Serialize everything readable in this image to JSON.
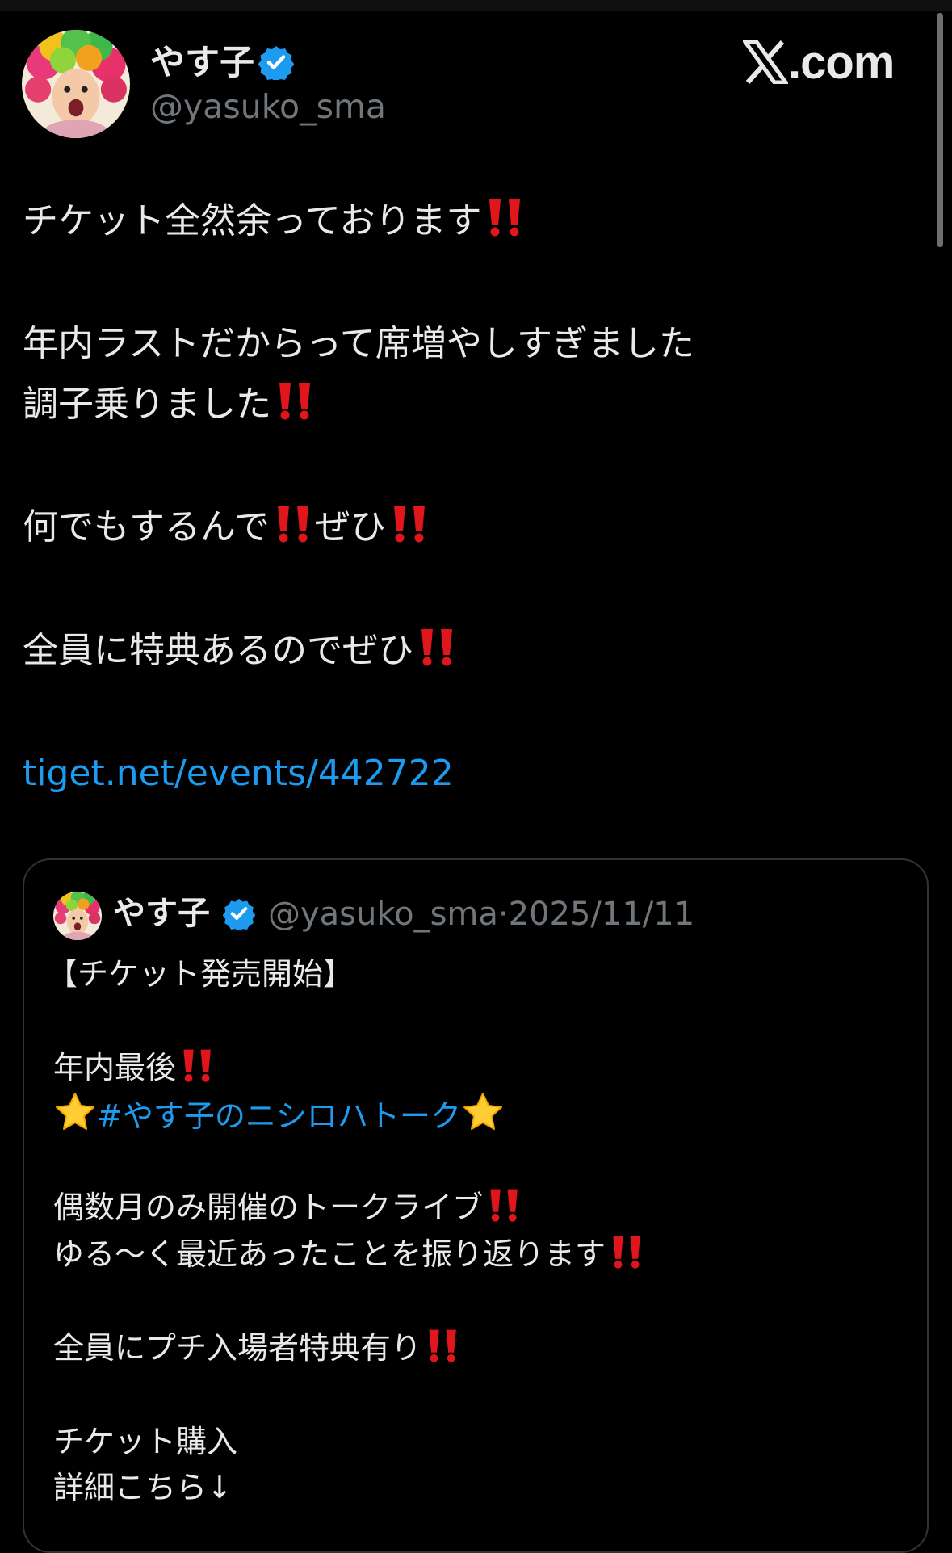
{
  "post": {
    "author": {
      "name": "やす子",
      "handle": "@yasuko_sma"
    },
    "brand": {
      "text": ".com"
    },
    "lines": {
      "l1": "チケット全然余っております",
      "l2": "年内ラストだからって席増やしすぎました",
      "l3": "調子乗りました",
      "l4a": "何でもするんで",
      "l4b": "ぜひ",
      "l5": "全員に特典あるのでぜひ",
      "link": "tiget.net/events/442722"
    }
  },
  "quote": {
    "author": {
      "name": "やす子",
      "handle": "@yasuko_sma",
      "separator": "·",
      "date": "2025/11/11"
    },
    "lines": {
      "q1": "【チケット発売開始】",
      "q2": "年内最後",
      "q3": "#やす子のニシロハトーク",
      "q4": "偶数月のみ開催のトークライブ",
      "q5": "ゆる〜く最近あったことを振り返ります",
      "q6": "全員にプチ入場者特典有り",
      "q7": "チケット購入",
      "q8": "詳細こちら↓"
    }
  },
  "icons": {
    "verified": "verified-badge-icon",
    "exclamation": "double-exclamation-icon",
    "star": "star-icon",
    "brand": "x-logo-icon"
  },
  "colors": {
    "background": "#000000",
    "text": "#e7e9ea",
    "muted": "#71767b",
    "link": "#1d9bf0",
    "verified": "#1d9bf0",
    "exclamation": "#e0161c",
    "star": "#ffcc33"
  }
}
